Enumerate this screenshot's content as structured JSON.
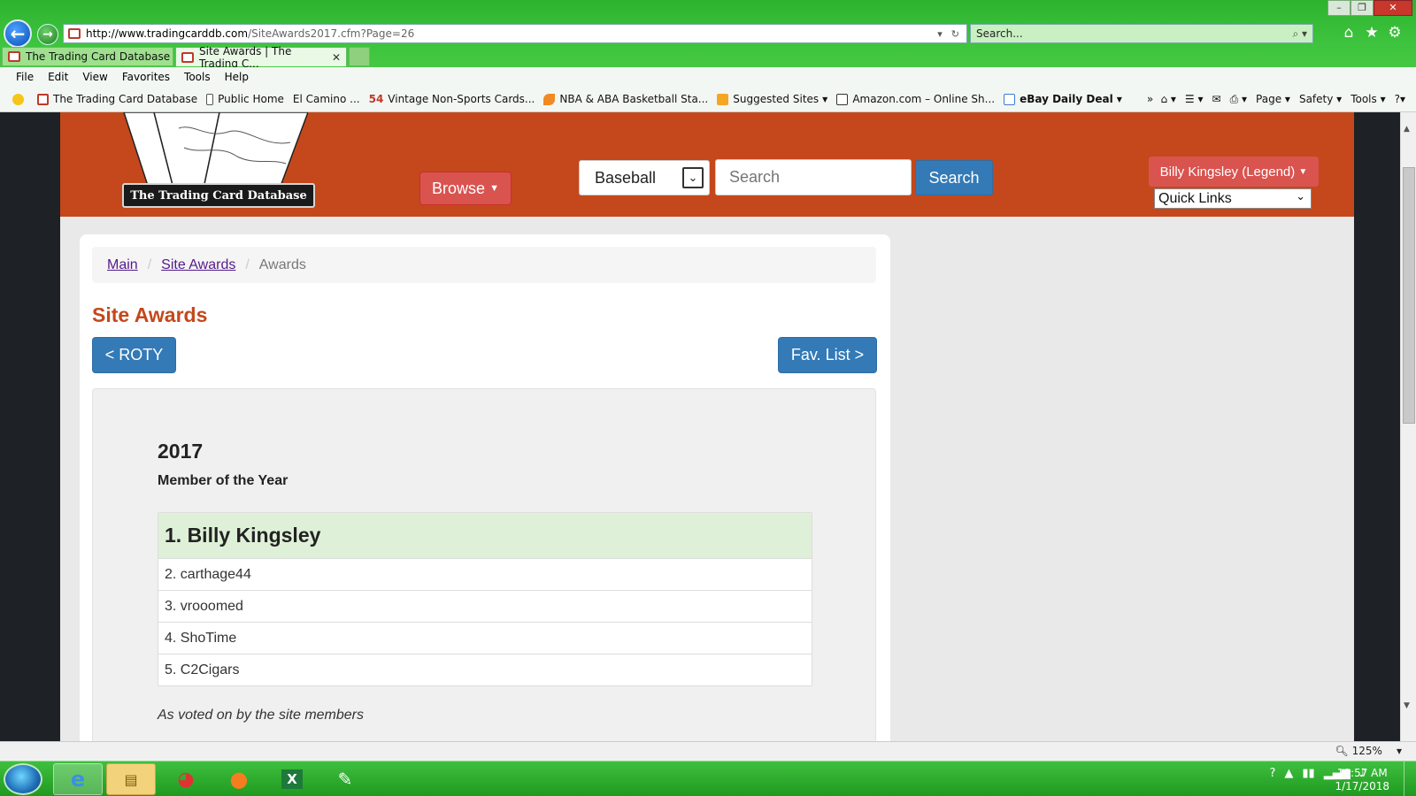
{
  "browser": {
    "url_main": "http://www.tradingcarddb.com",
    "url_rest": "/SiteAwards2017.cfm?Page=26",
    "search_placeholder": "Search...",
    "tabs": [
      {
        "label": "The Trading Card Database"
      },
      {
        "label": "Site Awards | The Trading C..."
      }
    ],
    "menu": [
      "File",
      "Edit",
      "View",
      "Favorites",
      "Tools",
      "Help"
    ],
    "favorites": [
      {
        "label": "The Trading Card Database"
      },
      {
        "label": "Public Home"
      },
      {
        "label": "El Camino ..."
      },
      {
        "label": "Vintage Non-Sports Cards...",
        "prefix": "54"
      },
      {
        "label": "NBA & ABA Basketball Sta..."
      },
      {
        "label": "Suggested Sites"
      },
      {
        "label": "Amazon.com – Online Sh..."
      },
      {
        "label": "eBay Daily Deal"
      }
    ],
    "commands": [
      "Page",
      "Safety",
      "Tools"
    ],
    "zoom": "125%"
  },
  "site": {
    "logo_text": "The Trading Card Database",
    "browse_label": "Browse",
    "sport_selected": "Baseball",
    "search_placeholder": "Search",
    "search_button": "Search",
    "user_label": "Billy Kingsley (Legend)",
    "quick_links": "Quick Links"
  },
  "breadcrumb": {
    "main": "Main",
    "site_awards": "Site Awards",
    "current": "Awards"
  },
  "page": {
    "title": "Site Awards",
    "prev_button": "< ROTY",
    "next_button": "Fav. List >"
  },
  "award": {
    "year": "2017",
    "name": "Member of the Year",
    "winners": [
      "1. Billy Kingsley",
      "2. carthage44",
      "3. vrooomed",
      "4. ShoTime",
      "5. C2Cigars"
    ],
    "note": "As voted on by the site members"
  },
  "taskbar": {
    "time": "10:57 AM",
    "date": "1/17/2018"
  },
  "colors": {
    "site_header": "#c4481b",
    "danger_button": "#d9534f",
    "primary_button": "#337ab7",
    "winner_highlight": "#dff0d8",
    "chrome_green": "#3ec43e"
  }
}
